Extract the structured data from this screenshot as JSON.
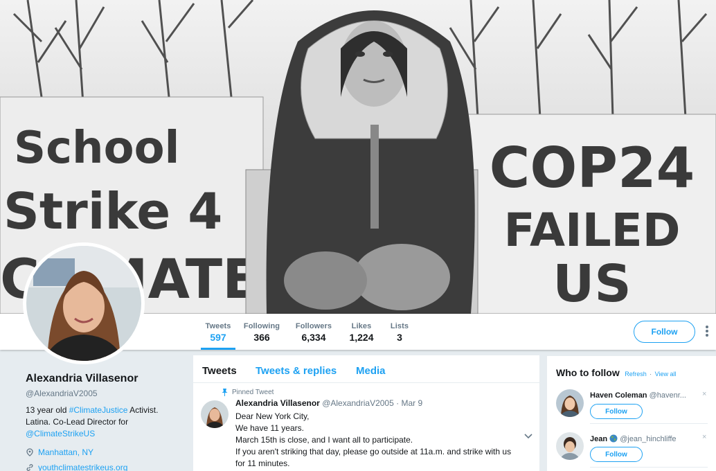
{
  "banner": {
    "sign_left": [
      "School",
      "Strike 4",
      "CLIMATE"
    ],
    "sign_right": [
      "COP24",
      "FAILED",
      "US"
    ]
  },
  "nav": {
    "stats": [
      {
        "label": "Tweets",
        "value": "597"
      },
      {
        "label": "Following",
        "value": "366"
      },
      {
        "label": "Followers",
        "value": "6,334"
      },
      {
        "label": "Likes",
        "value": "1,224"
      },
      {
        "label": "Lists",
        "value": "3"
      }
    ],
    "follow_label": "Follow"
  },
  "profile": {
    "name": "Alexandria Villasenor",
    "handle": "@AlexandriaV2005",
    "bio_pre": "13 year old ",
    "bio_hashtag": "#ClimateJustice",
    "bio_mid": " Activist. Latina. Co-Lead Director for ",
    "bio_mention": "@ClimateStrikeUS",
    "location": "Manhattan, NY",
    "website": "youthclimatestrikeus.org"
  },
  "timeline": {
    "tabs": [
      "Tweets",
      "Tweets & replies",
      "Media"
    ],
    "pinned_label": "Pinned Tweet",
    "tweet": {
      "name": "Alexandria Villasenor",
      "handle": "@AlexandriaV2005",
      "date": "Mar 9",
      "lines": [
        "Dear New York City,",
        "We have 11 years.",
        "March 15th is close, and I want all to participate.",
        "If you aren't striking that day, please go outside at 11a.m. and strike with us",
        "for 11 minutes."
      ]
    }
  },
  "who_to_follow": {
    "title": "Who to follow",
    "refresh": "Refresh",
    "separator": "·",
    "view_all": "View all",
    "suggestions": [
      {
        "name": "Haven Coleman",
        "handle": "@havenr...",
        "follow_label": "Follow",
        "dismiss": "×"
      },
      {
        "name": "Jean",
        "handle": "@jean_hinchliffe",
        "follow_label": "Follow",
        "dismiss": "×"
      }
    ]
  },
  "colors": {
    "accent": "#1da1f2",
    "text": "#14171a",
    "muted": "#657786",
    "background": "#e6ecf0"
  }
}
